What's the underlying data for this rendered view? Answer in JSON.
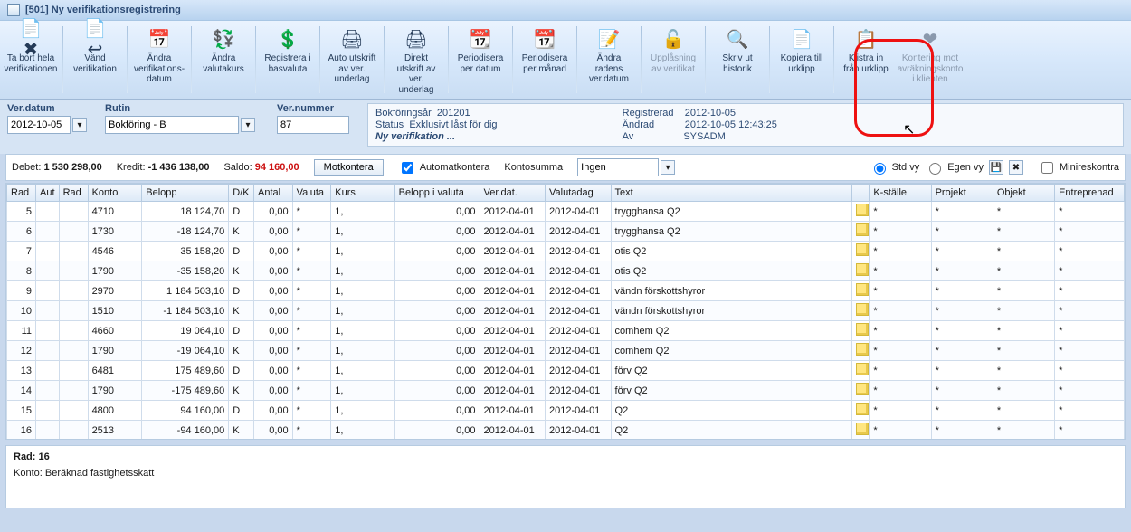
{
  "window": {
    "title": "[501]  Ny verifikationsregistrering"
  },
  "toolbar": [
    {
      "label": "Ta bort hela verifikationen",
      "icon": "📄✖",
      "enabled": true,
      "name": "delete-all"
    },
    {
      "label": "Vänd verifikation",
      "icon": "📄↩",
      "enabled": true,
      "name": "reverse"
    },
    {
      "label": "Ändra verifikations-datum",
      "icon": "📅",
      "enabled": true,
      "name": "change-date"
    },
    {
      "label": "Ändra valutakurs",
      "icon": "💱",
      "enabled": true,
      "name": "change-rate"
    },
    {
      "label": "Registrera i basvaluta",
      "icon": "💲",
      "enabled": true,
      "name": "base-currency"
    },
    {
      "label": "Auto utskrift av ver. underlag",
      "icon": "🖨",
      "enabled": true,
      "name": "auto-print"
    },
    {
      "label": "Direkt utskrift av ver. underlag",
      "icon": "🖨",
      "enabled": true,
      "name": "direct-print"
    },
    {
      "label": "Periodisera per datum",
      "icon": "📆",
      "enabled": true,
      "name": "periodize-date"
    },
    {
      "label": "Periodisera per månad",
      "icon": "📆",
      "enabled": true,
      "name": "periodize-month"
    },
    {
      "label": "Ändra radens ver.datum",
      "icon": "📝",
      "enabled": true,
      "name": "row-date"
    },
    {
      "label": "Upplåsning av verifikat",
      "icon": "🔓",
      "enabled": false,
      "name": "unlock"
    },
    {
      "label": "Skriv ut historik",
      "icon": "🔍",
      "enabled": true,
      "name": "print-history"
    },
    {
      "label": "Kopiera till urklipp",
      "icon": "📄",
      "enabled": true,
      "name": "copy-clipboard"
    },
    {
      "label": "Klistra in från urklipp",
      "icon": "📋",
      "enabled": true,
      "name": "paste-clipboard",
      "highlighted": true
    },
    {
      "label": "Kontering mot avräkningskonto i klienten",
      "icon": "❤",
      "enabled": false,
      "name": "client-account"
    }
  ],
  "fields": {
    "verdatum_label": "Ver.datum",
    "verdatum_value": "2012-10-05",
    "rutin_label": "Rutin",
    "rutin_value": "Bokföring - B",
    "vernummer_label": "Ver.nummer",
    "vernummer_value": "87"
  },
  "info": {
    "bokforingsar_label": "Bokföringsår",
    "bokforingsar_value": "201201",
    "status_label": "Status",
    "status_value": "Exklusivt låst för dig",
    "registrerad_label": "Registrerad",
    "registrerad_value": "2012-10-05",
    "andrad_label": "Ändrad",
    "andrad_value": "2012-10-05 12:43:25",
    "av_label": "Av",
    "av_value": "SYSADM",
    "footer": "Ny verifikation ..."
  },
  "summary": {
    "debet_label": "Debet:",
    "debet_value": "1 530 298,00",
    "kredit_label": "Kredit:",
    "kredit_value": "-1 436 138,00",
    "saldo_label": "Saldo:",
    "saldo_value": "94 160,00",
    "motkontera": "Motkontera",
    "automatkontera": "Automatkontera",
    "kontosumma_label": "Kontosumma",
    "kontosumma_value": "Ingen",
    "std_vy": "Std vy",
    "egen_vy": "Egen vy",
    "minireskontra": "Minireskontra"
  },
  "columns": [
    "Rad",
    "Aut",
    "Rad",
    "Konto",
    "Belopp",
    "D/K",
    "Antal",
    "Valuta",
    "Kurs",
    "Belopp i valuta",
    "Ver.dat.",
    "Valutadag",
    "Text",
    "",
    "K-ställe",
    "Projekt",
    "Objekt",
    "Entreprenad"
  ],
  "rows": [
    {
      "n": 5,
      "konto": "4710",
      "belopp": "18 124,70",
      "dk": "D",
      "antal": "0,00",
      "valuta": "*",
      "kurs": "1,",
      "biv": "0,00",
      "vdat": "2012-04-01",
      "valdag": "2012-04-01",
      "text": "trygghansa Q2"
    },
    {
      "n": 6,
      "konto": "1730",
      "belopp": "-18 124,70",
      "dk": "K",
      "antal": "0,00",
      "valuta": "*",
      "kurs": "1,",
      "biv": "0,00",
      "vdat": "2012-04-01",
      "valdag": "2012-04-01",
      "text": "trygghansa Q2"
    },
    {
      "n": 7,
      "konto": "4546",
      "belopp": "35 158,20",
      "dk": "D",
      "antal": "0,00",
      "valuta": "*",
      "kurs": "1,",
      "biv": "0,00",
      "vdat": "2012-04-01",
      "valdag": "2012-04-01",
      "text": "otis Q2"
    },
    {
      "n": 8,
      "konto": "1790",
      "belopp": "-35 158,20",
      "dk": "K",
      "antal": "0,00",
      "valuta": "*",
      "kurs": "1,",
      "biv": "0,00",
      "vdat": "2012-04-01",
      "valdag": "2012-04-01",
      "text": "otis Q2"
    },
    {
      "n": 9,
      "konto": "2970",
      "belopp": "1 184 503,10",
      "dk": "D",
      "antal": "0,00",
      "valuta": "*",
      "kurs": "1,",
      "biv": "0,00",
      "vdat": "2012-04-01",
      "valdag": "2012-04-01",
      "text": "vändn förskottshyror"
    },
    {
      "n": 10,
      "konto": "1510",
      "belopp": "-1 184 503,10",
      "dk": "K",
      "antal": "0,00",
      "valuta": "*",
      "kurs": "1,",
      "biv": "0,00",
      "vdat": "2012-04-01",
      "valdag": "2012-04-01",
      "text": "vändn förskottshyror"
    },
    {
      "n": 11,
      "konto": "4660",
      "belopp": "19 064,10",
      "dk": "D",
      "antal": "0,00",
      "valuta": "*",
      "kurs": "1,",
      "biv": "0,00",
      "vdat": "2012-04-01",
      "valdag": "2012-04-01",
      "text": "comhem Q2"
    },
    {
      "n": 12,
      "konto": "1790",
      "belopp": "-19 064,10",
      "dk": "K",
      "antal": "0,00",
      "valuta": "*",
      "kurs": "1,",
      "biv": "0,00",
      "vdat": "2012-04-01",
      "valdag": "2012-04-01",
      "text": "comhem Q2"
    },
    {
      "n": 13,
      "konto": "6481",
      "belopp": "175 489,60",
      "dk": "D",
      "antal": "0,00",
      "valuta": "*",
      "kurs": "1,",
      "biv": "0,00",
      "vdat": "2012-04-01",
      "valdag": "2012-04-01",
      "text": "förv Q2"
    },
    {
      "n": 14,
      "konto": "1790",
      "belopp": "-175 489,60",
      "dk": "K",
      "antal": "0,00",
      "valuta": "*",
      "kurs": "1,",
      "biv": "0,00",
      "vdat": "2012-04-01",
      "valdag": "2012-04-01",
      "text": "förv Q2"
    },
    {
      "n": 15,
      "konto": "4800",
      "belopp": "94 160,00",
      "dk": "D",
      "antal": "0,00",
      "valuta": "*",
      "kurs": "1,",
      "biv": "0,00",
      "vdat": "2012-04-01",
      "valdag": "2012-04-01",
      "text": "Q2"
    },
    {
      "n": 16,
      "konto": "2513",
      "belopp": "-94 160,00",
      "dk": "K",
      "antal": "0,00",
      "valuta": "*",
      "kurs": "1,",
      "biv": "0,00",
      "vdat": "2012-04-01",
      "valdag": "2012-04-01",
      "text": "Q2"
    }
  ],
  "row_tail": {
    "kstalle": "*",
    "projekt": "*",
    "objekt": "*",
    "entr": "*"
  },
  "footer": {
    "rad": "Rad: 16",
    "konto": "Konto: Beräknad fastighetsskatt"
  }
}
